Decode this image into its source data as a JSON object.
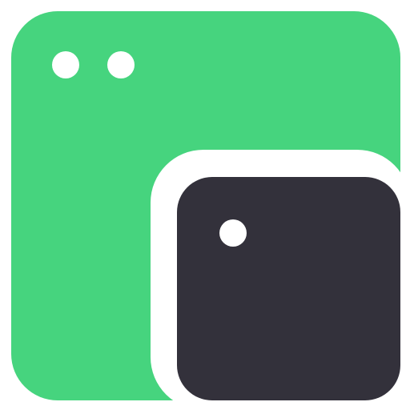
{
  "icon": {
    "semantic": "overlapping-windows-app-icon",
    "colors": {
      "background": "#ffffff",
      "back_window": "#46d47e",
      "front_window": "#33313b",
      "dots": "#ffffff",
      "gap_outline": "#ffffff"
    },
    "back_window": {
      "dots_visible": 2
    },
    "front_window": {
      "dots_visible": 1
    }
  }
}
